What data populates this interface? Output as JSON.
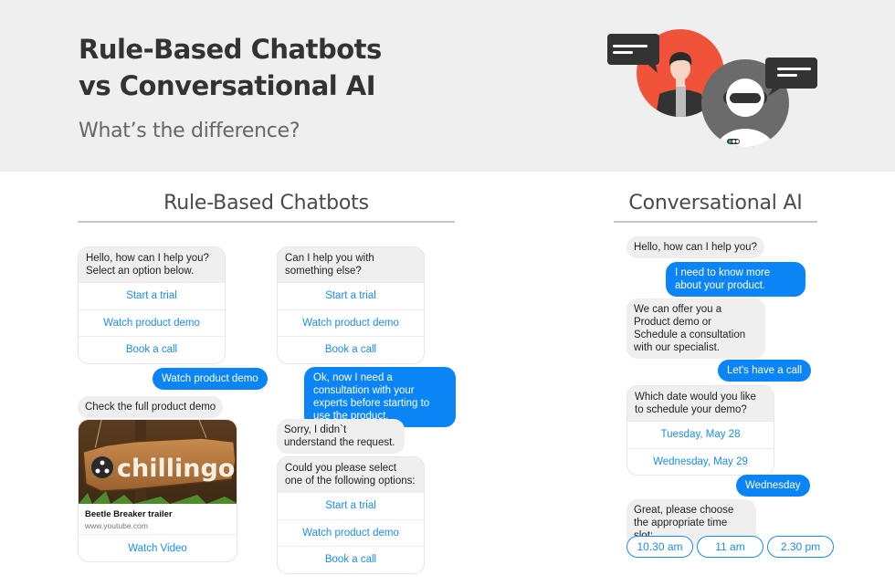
{
  "header": {
    "title_line1": "Rule-Based Chatbots",
    "title_line2": "vs Conversational AI",
    "subtitle": "What’s the difference?"
  },
  "colors": {
    "accent_blue": "#0b84f5",
    "link_blue": "#1a8cf0",
    "bot_bubble": "#efefef",
    "header_bg": "#efefef",
    "person_circle": "#f0533a",
    "robot_circle": "#6b6b6b"
  },
  "rule_based": {
    "heading": "Rule-Based Chatbots",
    "col1": {
      "menu1": {
        "prompt": "Hello, how can I help you? Select an option below.",
        "options": [
          "Start a trial",
          "Watch product demo",
          "Book a call"
        ]
      },
      "user_reply": "Watch product demo",
      "bot_reply": "Check the full product demo",
      "media": {
        "image_text": "chillingo",
        "title": "Beetle Breaker trailer",
        "url": "www.youtube.com",
        "button": "Watch Video"
      }
    },
    "col2": {
      "menu1": {
        "prompt": "Can I help you with something else?",
        "options": [
          "Start a trial",
          "Watch product demo",
          "Book a call"
        ]
      },
      "user_reply": "Ok, now I need a consultation with your experts before starting to use the product.",
      "bot_error": "Sorry, I didn`t understand the request.",
      "menu2": {
        "prompt": "Could you please select one of the following options:",
        "options": [
          "Start a trial",
          "Watch product demo",
          "Book a call"
        ]
      }
    }
  },
  "conversational": {
    "heading": "Conversational AI",
    "greeting": "Hello, how can I help you?",
    "user1": "I need to know more about your product.",
    "bot1": "We can offer you a Product demo or Schedule a consultation with our specialist.",
    "user2": "Let's have a call",
    "date_menu": {
      "prompt": "Which date would you like to schedule your demo?",
      "options": [
        "Tuesday, May 28",
        "Wednesday, May 29"
      ]
    },
    "user3": "Wednesday",
    "bot2": "Great, please choose the appropriate time slot:",
    "time_slots": [
      "10.30 am",
      "11 am",
      "2.30 pm"
    ]
  },
  "icons": {
    "hero": "person-and-robot-chat-illustration"
  }
}
